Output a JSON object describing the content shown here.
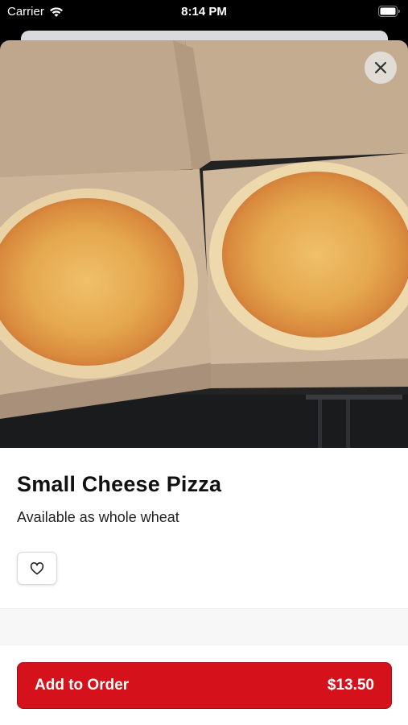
{
  "status_bar": {
    "carrier": "Carrier",
    "time": "8:14 PM",
    "icons": [
      "wifi-icon",
      "battery-icon"
    ]
  },
  "item": {
    "photo_alt": "pizza-photo",
    "title": "Small Cheese Pizza",
    "description": "Available as whole wheat"
  },
  "actions": {
    "close_icon": "close-icon",
    "favorite_icon": "heart-icon",
    "add_to_order_label": "Add to Order",
    "price": "$13.50"
  },
  "colors": {
    "accent": "#d5121b",
    "background": "#ffffff",
    "status_bar": "#000000"
  }
}
